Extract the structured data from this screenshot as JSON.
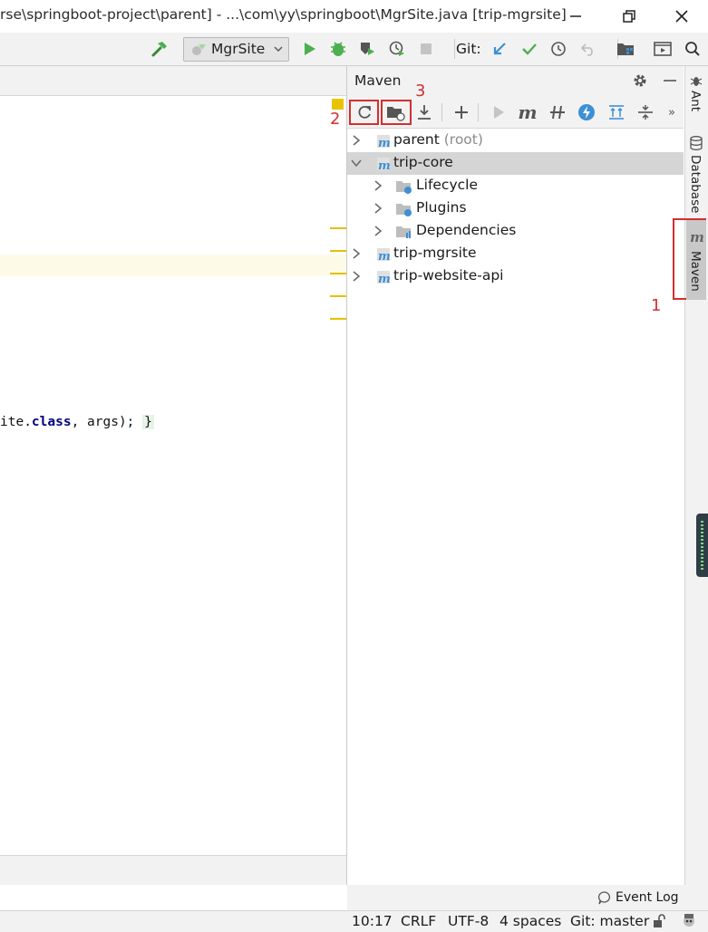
{
  "window": {
    "title": "rse\\springboot-project\\parent] - ...\\com\\yy\\springboot\\MgrSite.java [trip-mgrsite]"
  },
  "toolbar": {
    "run_config": "MgrSite",
    "git_label": "Git:"
  },
  "editor": {
    "code_prefix": "ite.",
    "code_keyword": "class",
    "code_suffix": ", args); ",
    "code_brace": "}"
  },
  "maven": {
    "title": "Maven",
    "tree": [
      {
        "label": "parent",
        "suffix": " (root)"
      },
      {
        "label": "trip-core"
      },
      {
        "label": "Lifecycle"
      },
      {
        "label": "Plugins"
      },
      {
        "label": "Dependencies"
      },
      {
        "label": "trip-mgrsite"
      },
      {
        "label": "trip-website-api"
      }
    ]
  },
  "right_strip": {
    "ant": "Ant",
    "database": "Database",
    "maven": "Maven"
  },
  "annotations": {
    "one": "1",
    "two": "2",
    "three": "3"
  },
  "status": {
    "event_log": "Event Log",
    "position": "10:17",
    "line_sep": "CRLF",
    "encoding": "UTF-8",
    "indent": "4 spaces",
    "git": "Git: master"
  },
  "colors": {
    "annotation_red": "#d32f2f",
    "accent_blue": "#3d8fd6",
    "run_green": "#4caf50"
  }
}
